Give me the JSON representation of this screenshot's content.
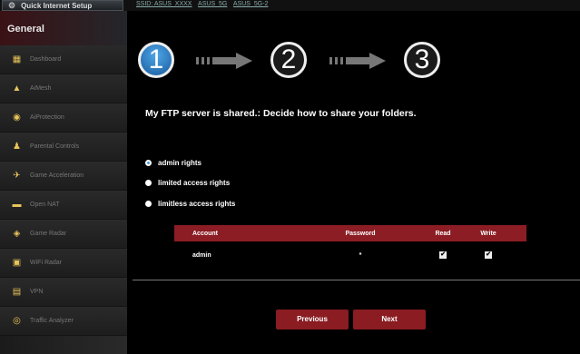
{
  "top": {
    "qis_label": "Quick Internet Setup",
    "links": [
      "SSID: ASUS_XXXX",
      "ASUS_5G",
      "ASUS_5G-2"
    ]
  },
  "sidebar": {
    "header": "General",
    "items": [
      {
        "label": "Dashboard",
        "icon": "dashboard-icon"
      },
      {
        "label": "AiMesh",
        "icon": "aimesh-icon"
      },
      {
        "label": "AiProtection",
        "icon": "aiprotection-icon"
      },
      {
        "label": "Parental Controls",
        "icon": "parental-controls-icon"
      },
      {
        "label": "Game Acceleration",
        "icon": "game-acceleration-icon"
      },
      {
        "label": "Open NAT",
        "icon": "open-nat-icon"
      },
      {
        "label": "Game Radar",
        "icon": "game-radar-icon"
      },
      {
        "label": "WiFi Radar",
        "icon": "wifi-radar-icon"
      },
      {
        "label": "VPN",
        "icon": "vpn-icon"
      },
      {
        "label": "Traffic Analyzer",
        "icon": "traffic-analyzer-icon"
      }
    ]
  },
  "steps": {
    "step1": "1",
    "step2": "2",
    "step3": "3",
    "active": 1
  },
  "main": {
    "title": "My FTP server is shared.: Decide how to share your folders.",
    "options": {
      "admin": "admin rights",
      "limited": "limited access rights",
      "limitless": "limitless access rights",
      "selected": "admin rights"
    },
    "table": {
      "headers": {
        "account": "Account",
        "password": "Password",
        "read": "Read",
        "write": "Write"
      },
      "rows": [
        {
          "account": "admin",
          "password": "*",
          "read": true,
          "write": true
        }
      ]
    },
    "buttons": {
      "previous": "Previous",
      "next": "Next"
    }
  },
  "colors": {
    "accent_red": "#8a1c22",
    "step_active_blue": "#2a7bc8",
    "icon_gold": "#e8c45a"
  }
}
